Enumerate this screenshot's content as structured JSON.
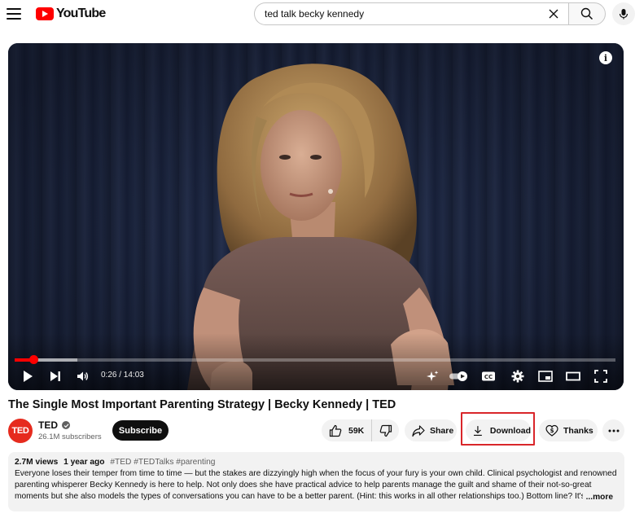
{
  "header": {
    "logo_text": "YouTube",
    "search_value": "ted talk becky kennedy"
  },
  "player": {
    "time_display": "0:26 / 14:03",
    "progress_played": 0.031,
    "progress_buffered": 0.105,
    "colors": {
      "progress": "#ff0000",
      "background": "#1c2438"
    }
  },
  "video": {
    "title": "The Single Most Important Parenting Strategy | Becky Kennedy | TED"
  },
  "channel": {
    "avatar_text": "TED",
    "name": "TED",
    "subscribers": "26.1M subscribers",
    "subscribe_label": "Subscribe"
  },
  "actions": {
    "likes": "59K",
    "share_label": "Share",
    "download_label": "Download",
    "thanks_label": "Thanks"
  },
  "description": {
    "views": "2.7M views",
    "age": "1 year ago",
    "tags": "#TED #TEDTalks #parenting",
    "text": "Everyone loses their temper from time to time — but the stakes are dizzyingly high when the focus of your fury is your own child. Clinical psychologist and renowned parenting whisperer Becky Kennedy is here to help. Not only does she have practical advice to help parents manage the guilt and shame of their not-so-great moments but she also models the types of conversations you can have to be a better parent. (Hint: this works in all other relationships too.) Bottom line? It's",
    "more_label": "...more"
  }
}
